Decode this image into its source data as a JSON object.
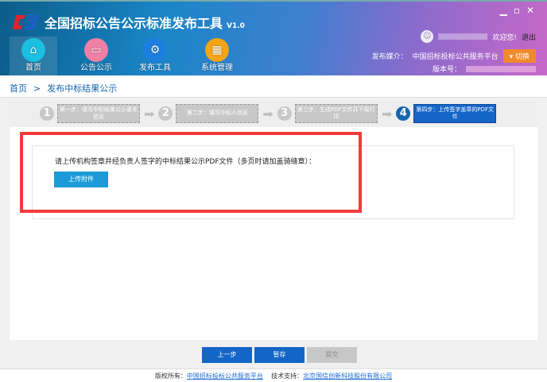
{
  "header": {
    "title": "全国招标公告公示标准发布工具",
    "version": "V1.0",
    "nav": [
      {
        "label": "首页",
        "icon": "home-icon",
        "color": "#1bbfe0"
      },
      {
        "label": "公告公示",
        "icon": "board-icon",
        "color": "#f07fa5"
      },
      {
        "label": "发布工具",
        "icon": "gear-icon",
        "color": "#1c7fe0"
      },
      {
        "label": "系统管理",
        "icon": "apps-icon",
        "color": "#f3a516"
      }
    ],
    "welcome": "欢迎您!",
    "logout": "退出",
    "media_label": "发布媒介：",
    "media_value": "中国招标投标公共服务平台",
    "switch": "▾ 切换",
    "version_label": "版本号："
  },
  "breadcrumb": {
    "home": "首页",
    "sep": ">",
    "current": "发布中标结果公示"
  },
  "steps": [
    {
      "num": "1",
      "label": "第一步：填写中标结果公示基本信息"
    },
    {
      "num": "2",
      "label": "第二步：填写中标人信息"
    },
    {
      "num": "3",
      "label": "第三步：生成PDF文件并下载打印"
    },
    {
      "num": "4",
      "label": "第四步：上传签字盖章的PDF文件"
    }
  ],
  "main": {
    "prompt": "请上传机构签章并经负责人签字的中标结果公示PDF文件（多页时请加盖骑缝章）：",
    "upload": "上传附件"
  },
  "buttons": {
    "prev": "上一步",
    "save": "暂存",
    "submit": "提交"
  },
  "footer": {
    "copyright_label": "版权所有：",
    "copyright": "中国招标投标公共服务平台",
    "support_label": "技术支持：",
    "support": "北京国信创新科技股份有限公司"
  }
}
